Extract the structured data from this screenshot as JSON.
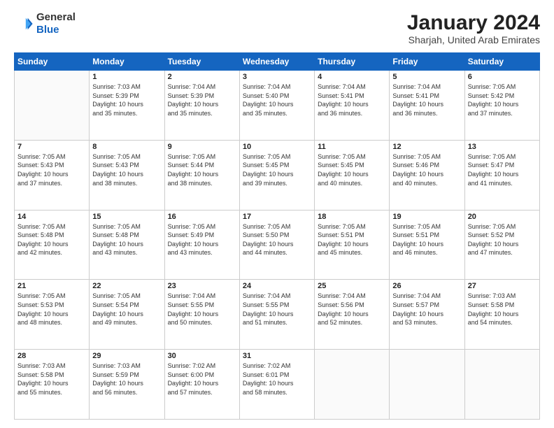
{
  "logo": {
    "general": "General",
    "blue": "Blue"
  },
  "title": "January 2024",
  "location": "Sharjah, United Arab Emirates",
  "days_of_week": [
    "Sunday",
    "Monday",
    "Tuesday",
    "Wednesday",
    "Thursday",
    "Friday",
    "Saturday"
  ],
  "weeks": [
    [
      {
        "day": "",
        "sunrise": "",
        "sunset": "",
        "daylight": ""
      },
      {
        "day": "1",
        "sunrise": "Sunrise: 7:03 AM",
        "sunset": "Sunset: 5:39 PM",
        "daylight": "Daylight: 10 hours and 35 minutes."
      },
      {
        "day": "2",
        "sunrise": "Sunrise: 7:04 AM",
        "sunset": "Sunset: 5:39 PM",
        "daylight": "Daylight: 10 hours and 35 minutes."
      },
      {
        "day": "3",
        "sunrise": "Sunrise: 7:04 AM",
        "sunset": "Sunset: 5:40 PM",
        "daylight": "Daylight: 10 hours and 35 minutes."
      },
      {
        "day": "4",
        "sunrise": "Sunrise: 7:04 AM",
        "sunset": "Sunset: 5:41 PM",
        "daylight": "Daylight: 10 hours and 36 minutes."
      },
      {
        "day": "5",
        "sunrise": "Sunrise: 7:04 AM",
        "sunset": "Sunset: 5:41 PM",
        "daylight": "Daylight: 10 hours and 36 minutes."
      },
      {
        "day": "6",
        "sunrise": "Sunrise: 7:05 AM",
        "sunset": "Sunset: 5:42 PM",
        "daylight": "Daylight: 10 hours and 37 minutes."
      }
    ],
    [
      {
        "day": "7",
        "sunrise": "Sunrise: 7:05 AM",
        "sunset": "Sunset: 5:43 PM",
        "daylight": "Daylight: 10 hours and 37 minutes."
      },
      {
        "day": "8",
        "sunrise": "Sunrise: 7:05 AM",
        "sunset": "Sunset: 5:43 PM",
        "daylight": "Daylight: 10 hours and 38 minutes."
      },
      {
        "day": "9",
        "sunrise": "Sunrise: 7:05 AM",
        "sunset": "Sunset: 5:44 PM",
        "daylight": "Daylight: 10 hours and 38 minutes."
      },
      {
        "day": "10",
        "sunrise": "Sunrise: 7:05 AM",
        "sunset": "Sunset: 5:45 PM",
        "daylight": "Daylight: 10 hours and 39 minutes."
      },
      {
        "day": "11",
        "sunrise": "Sunrise: 7:05 AM",
        "sunset": "Sunset: 5:45 PM",
        "daylight": "Daylight: 10 hours and 40 minutes."
      },
      {
        "day": "12",
        "sunrise": "Sunrise: 7:05 AM",
        "sunset": "Sunset: 5:46 PM",
        "daylight": "Daylight: 10 hours and 40 minutes."
      },
      {
        "day": "13",
        "sunrise": "Sunrise: 7:05 AM",
        "sunset": "Sunset: 5:47 PM",
        "daylight": "Daylight: 10 hours and 41 minutes."
      }
    ],
    [
      {
        "day": "14",
        "sunrise": "Sunrise: 7:05 AM",
        "sunset": "Sunset: 5:48 PM",
        "daylight": "Daylight: 10 hours and 42 minutes."
      },
      {
        "day": "15",
        "sunrise": "Sunrise: 7:05 AM",
        "sunset": "Sunset: 5:48 PM",
        "daylight": "Daylight: 10 hours and 43 minutes."
      },
      {
        "day": "16",
        "sunrise": "Sunrise: 7:05 AM",
        "sunset": "Sunset: 5:49 PM",
        "daylight": "Daylight: 10 hours and 43 minutes."
      },
      {
        "day": "17",
        "sunrise": "Sunrise: 7:05 AM",
        "sunset": "Sunset: 5:50 PM",
        "daylight": "Daylight: 10 hours and 44 minutes."
      },
      {
        "day": "18",
        "sunrise": "Sunrise: 7:05 AM",
        "sunset": "Sunset: 5:51 PM",
        "daylight": "Daylight: 10 hours and 45 minutes."
      },
      {
        "day": "19",
        "sunrise": "Sunrise: 7:05 AM",
        "sunset": "Sunset: 5:51 PM",
        "daylight": "Daylight: 10 hours and 46 minutes."
      },
      {
        "day": "20",
        "sunrise": "Sunrise: 7:05 AM",
        "sunset": "Sunset: 5:52 PM",
        "daylight": "Daylight: 10 hours and 47 minutes."
      }
    ],
    [
      {
        "day": "21",
        "sunrise": "Sunrise: 7:05 AM",
        "sunset": "Sunset: 5:53 PM",
        "daylight": "Daylight: 10 hours and 48 minutes."
      },
      {
        "day": "22",
        "sunrise": "Sunrise: 7:05 AM",
        "sunset": "Sunset: 5:54 PM",
        "daylight": "Daylight: 10 hours and 49 minutes."
      },
      {
        "day": "23",
        "sunrise": "Sunrise: 7:04 AM",
        "sunset": "Sunset: 5:55 PM",
        "daylight": "Daylight: 10 hours and 50 minutes."
      },
      {
        "day": "24",
        "sunrise": "Sunrise: 7:04 AM",
        "sunset": "Sunset: 5:55 PM",
        "daylight": "Daylight: 10 hours and 51 minutes."
      },
      {
        "day": "25",
        "sunrise": "Sunrise: 7:04 AM",
        "sunset": "Sunset: 5:56 PM",
        "daylight": "Daylight: 10 hours and 52 minutes."
      },
      {
        "day": "26",
        "sunrise": "Sunrise: 7:04 AM",
        "sunset": "Sunset: 5:57 PM",
        "daylight": "Daylight: 10 hours and 53 minutes."
      },
      {
        "day": "27",
        "sunrise": "Sunrise: 7:03 AM",
        "sunset": "Sunset: 5:58 PM",
        "daylight": "Daylight: 10 hours and 54 minutes."
      }
    ],
    [
      {
        "day": "28",
        "sunrise": "Sunrise: 7:03 AM",
        "sunset": "Sunset: 5:58 PM",
        "daylight": "Daylight: 10 hours and 55 minutes."
      },
      {
        "day": "29",
        "sunrise": "Sunrise: 7:03 AM",
        "sunset": "Sunset: 5:59 PM",
        "daylight": "Daylight: 10 hours and 56 minutes."
      },
      {
        "day": "30",
        "sunrise": "Sunrise: 7:02 AM",
        "sunset": "Sunset: 6:00 PM",
        "daylight": "Daylight: 10 hours and 57 minutes."
      },
      {
        "day": "31",
        "sunrise": "Sunrise: 7:02 AM",
        "sunset": "Sunset: 6:01 PM",
        "daylight": "Daylight: 10 hours and 58 minutes."
      },
      {
        "day": "",
        "sunrise": "",
        "sunset": "",
        "daylight": ""
      },
      {
        "day": "",
        "sunrise": "",
        "sunset": "",
        "daylight": ""
      },
      {
        "day": "",
        "sunrise": "",
        "sunset": "",
        "daylight": ""
      }
    ]
  ]
}
